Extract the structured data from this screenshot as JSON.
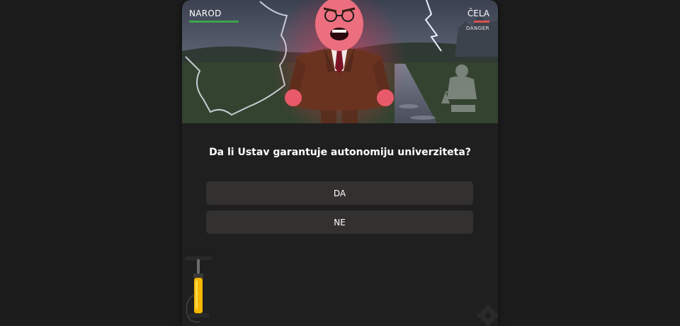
{
  "hud": {
    "left_label": "NAROD",
    "left_level": 1.0,
    "left_color": "#3fa34d",
    "right_label": "ČELA",
    "right_level": 1.0,
    "right_color": "#d9534f",
    "right_status": "DANGER"
  },
  "scene": {
    "character": "angry-politician",
    "background": "stormy-road-with-map-outline",
    "icons": [
      "lightning-icon",
      "justice-statue-icon"
    ]
  },
  "question": {
    "text": "Da li Ustav garantuje autonomiju univerziteta?"
  },
  "answers": [
    {
      "label": "DA"
    },
    {
      "label": "NE"
    }
  ],
  "tools": {
    "pump": "pump-icon",
    "settings": "gear-icon"
  },
  "colors": {
    "page_bg": "#1c1c1c",
    "card_bg": "#1f1f1f",
    "button_bg": "#333030",
    "pump_yellow": "#f5b800"
  }
}
